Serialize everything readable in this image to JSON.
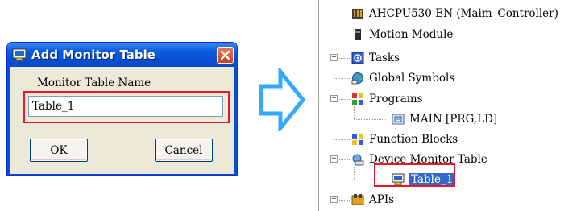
{
  "dialog": {
    "title": "Add Monitor Table",
    "field_label": "Monitor Table Name",
    "field_value": "Table_1",
    "ok_label": "OK",
    "cancel_label": "Cancel",
    "close_icon": "close-icon",
    "title_icon": "monitor-icon"
  },
  "arrow": {
    "icon": "arrow-right-icon",
    "color": "#33aaff"
  },
  "tree": {
    "items": [
      {
        "label": "AHCPU530-EN  (Maim_Controller)",
        "icon": "cpu-icon"
      },
      {
        "label": "Motion Module",
        "icon": "module-icon"
      },
      {
        "label": "Tasks",
        "icon": "tasks-icon"
      },
      {
        "label": "Global Symbols",
        "icon": "globe-icon"
      },
      {
        "label": "Programs",
        "icon": "programs-icon"
      },
      {
        "label": "MAIN [PRG,LD]",
        "icon": "program-icon"
      },
      {
        "label": "Function Blocks",
        "icon": "function-blocks-icon"
      },
      {
        "label": "Device Monitor Table",
        "icon": "device-monitor-icon"
      },
      {
        "label": "Table_1",
        "icon": "monitor-icon"
      },
      {
        "label": "APIs",
        "icon": "apis-icon"
      }
    ]
  },
  "colors": {
    "highlight": "#e8162a",
    "selection": "#316ac5",
    "titlebar": "#0a5be0"
  }
}
